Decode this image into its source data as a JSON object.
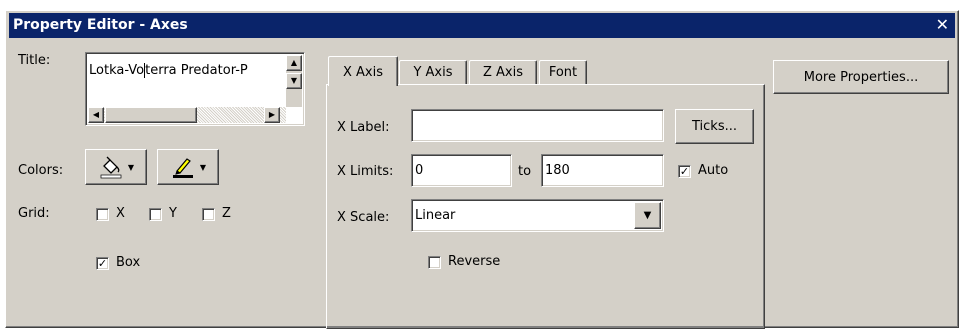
{
  "window": {
    "title": "Property Editor - Axes",
    "close_glyph": "✕"
  },
  "left": {
    "title_label": "Title:",
    "title_value_before_cursor": "Lotka-Vo",
    "title_value_after_cursor": "terra Predator-P",
    "colors_label": "Colors:",
    "grid_label": "Grid:",
    "grid_options": [
      {
        "label": "X",
        "checked": false
      },
      {
        "label": "Y",
        "checked": false
      },
      {
        "label": "Z",
        "checked": false
      }
    ],
    "box": {
      "label": "Box",
      "checked": true
    }
  },
  "tabs": [
    {
      "label": "X Axis",
      "active": true
    },
    {
      "label": "Y Axis",
      "active": false
    },
    {
      "label": "Z Axis",
      "active": false
    },
    {
      "label": "Font",
      "active": false
    }
  ],
  "xaxis": {
    "label_label": "X Label:",
    "label_value": "",
    "ticks_button": "Ticks...",
    "limits_label": "X Limits:",
    "limit_min": "0",
    "to_label": "to",
    "limit_max": "180",
    "auto": {
      "label": "Auto",
      "checked": true
    },
    "scale_label": "X Scale:",
    "scale_value": "Linear",
    "reverse": {
      "label": "Reverse",
      "checked": false
    }
  },
  "more_properties_button": "More Properties...",
  "icons": {
    "fill_color": "paint-bucket-icon",
    "edge_color": "pen-icon",
    "dropdown": "triangle-down-icon"
  },
  "colors": {
    "titlebar": "#0a246a",
    "face": "#d4d0c8",
    "fill_swatch": "#ffffff",
    "edge_swatch": "#000000"
  }
}
